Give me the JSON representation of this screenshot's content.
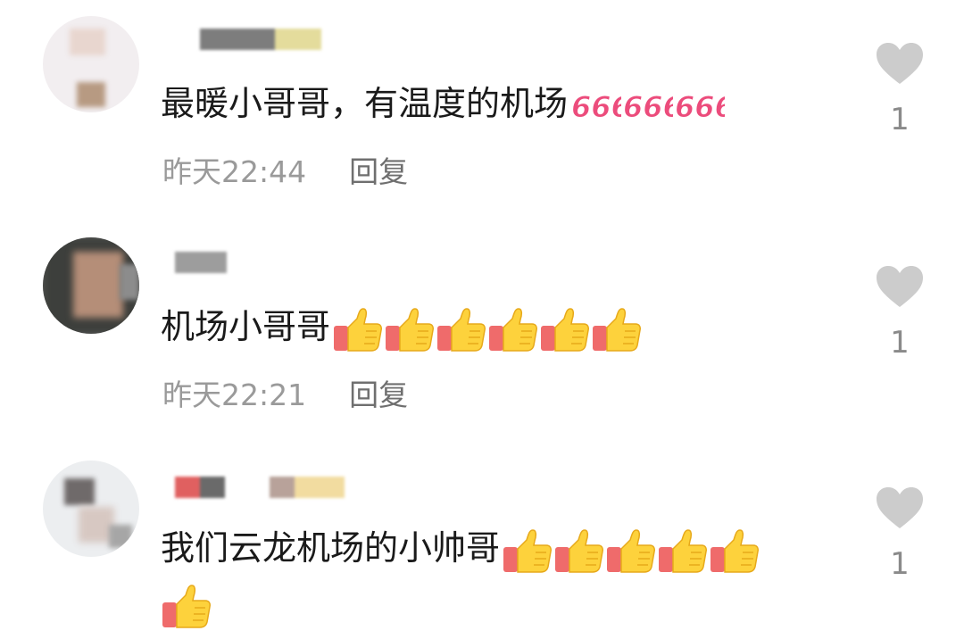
{
  "comments": [
    {
      "text": "最暖小哥哥，有温度的机场",
      "emoji": "666",
      "emoji_count": 3,
      "time": "昨天22:44",
      "reply_label": "回复",
      "likes": "1"
    },
    {
      "text": "机场小哥哥",
      "emoji": "thumbs-up",
      "emoji_count": 6,
      "time": "昨天22:21",
      "reply_label": "回复",
      "likes": "1"
    },
    {
      "text": "我们云龙机场的小帅哥",
      "emoji": "thumbs-up",
      "emoji_count": 6,
      "likes": "1"
    }
  ],
  "colors": {
    "like_icon": "#cccccc",
    "time_text": "#9a9a9a",
    "reply_text": "#6f6f6f"
  }
}
